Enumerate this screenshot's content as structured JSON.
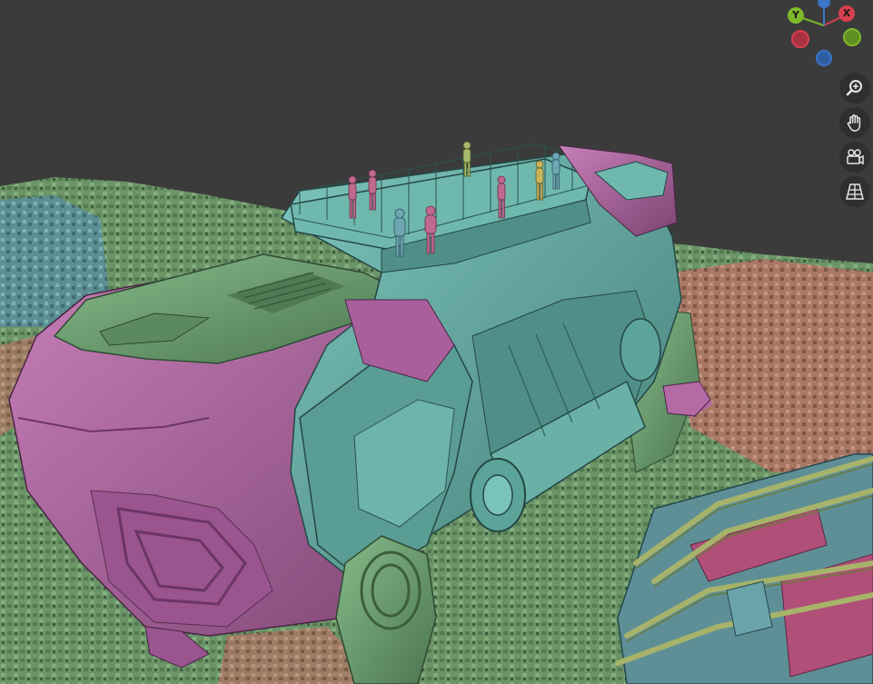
{
  "viewport": {
    "gizmo": {
      "x_label": "X",
      "y_label": "Y",
      "colors": {
        "x": "#d83f4f",
        "y": "#7fb82a",
        "z": "#3b74c8",
        "x_neg": "#a83242",
        "y_neg": "#5f8e22",
        "z_neg": "#2f5c9f"
      }
    },
    "nav_buttons": [
      {
        "name": "zoom",
        "icon": "zoom-icon"
      },
      {
        "name": "pan",
        "icon": "hand-icon"
      },
      {
        "name": "camera",
        "icon": "camera-icon"
      },
      {
        "name": "perspective",
        "icon": "grid-perspective-icon"
      }
    ],
    "colors": {
      "background": "#3b3b3b",
      "teal": "#5fa7a0",
      "green": "#6f9f6a",
      "magenta": "#b36aa5",
      "salmon": "#b5836e",
      "olive": "#8fa864"
    }
  }
}
